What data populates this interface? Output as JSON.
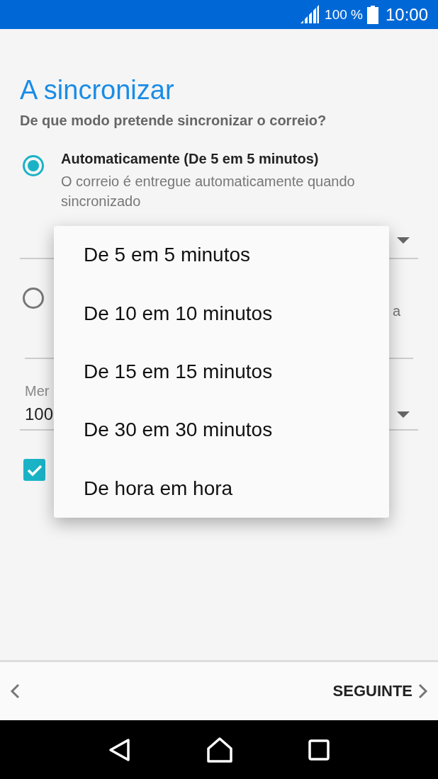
{
  "status_bar": {
    "battery": "100 %",
    "time": "10:00"
  },
  "title": "A sincronizar",
  "question": "De que modo pretende sincronizar o correio?",
  "sync_options": [
    {
      "label": "Automaticamente (De 5 em 5 minutos)",
      "description": "O correio é entregue automaticamente quando sincronizado",
      "selected": true
    },
    {
      "description": "a",
      "selected": false
    }
  ],
  "mail_field": {
    "label": "Mer",
    "value": "100"
  },
  "checkbox": {
    "checked": true
  },
  "menu": {
    "items": [
      "De 5 em 5 minutos",
      "De 10 em 10 minutos",
      "De 15 em 15 minutos",
      "De 30 em 30 minutos",
      "De hora em hora"
    ]
  },
  "footer": {
    "next": "SEGUINTE"
  }
}
